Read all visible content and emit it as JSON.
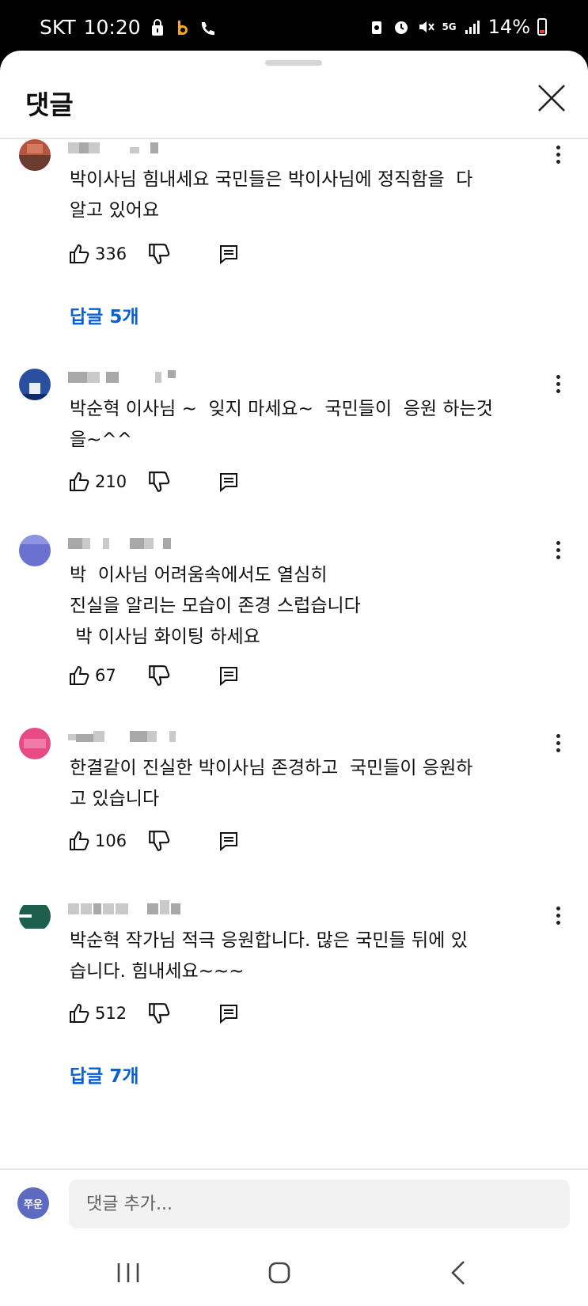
{
  "status_bar": {
    "carrier": "SKT",
    "time": "10:20",
    "network": "5G",
    "battery_percent": "14%",
    "icons": [
      "lock-icon",
      "b-app-icon",
      "call-icon",
      "recycle-icon",
      "alarm-icon",
      "mute-icon",
      "signal-icon",
      "battery-icon"
    ]
  },
  "header": {
    "title": "댓글"
  },
  "comments": [
    {
      "text": "박이사님 힘내세요 국민들은 박이사님에 정직함을  다\n알고 있어요",
      "likes": "336",
      "replies_label": "답글 5개",
      "avatar_color": "#b5553f"
    },
    {
      "text": "박순혁 이사님 ~  잊지 마세요~  국민들이  응원 하는것\n을~^^",
      "likes": "210",
      "replies_label": "",
      "avatar_color": "#2b4fa0"
    },
    {
      "text": "박  이사님 어려움속에서도 열심히\n진실을 알리는 모습이 존경 스럽습니다\n 박 이사님 화이팅 하세요",
      "likes": "67",
      "replies_label": "",
      "avatar_color": "#6a71cf"
    },
    {
      "text": "한결같이 진실한 박이사님 존경하고  국민들이 응원하\n고 있습니다",
      "likes": "106",
      "replies_label": "",
      "avatar_color": "#e84a83"
    },
    {
      "text": "박순혁 작가님 적극 응원합니다. 많은 국민들 뒤에 있\n습니다. 힘내세요~~~",
      "likes": "512",
      "replies_label": "답글 7개",
      "avatar_color": "#1d5e4c"
    }
  ],
  "footer": {
    "user_avatar_label": "쭈운",
    "add_comment_placeholder": "댓글 추가..."
  },
  "colors": {
    "link": "#065fd4",
    "background": "#ffffff"
  }
}
